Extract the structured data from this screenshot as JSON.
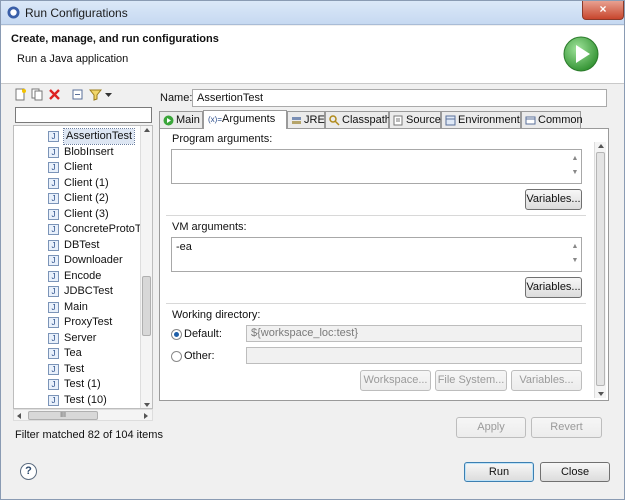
{
  "window": {
    "title": "Run Configurations",
    "close_glyph": "×"
  },
  "banner": {
    "heading": "Create, manage, and run configurations",
    "subtitle": "Run a Java application",
    "icon": "run-play-icon"
  },
  "left": {
    "filter_value": "",
    "items": [
      "AssertionTest",
      "BlobInsert",
      "Client",
      "Client (1)",
      "Client (2)",
      "Client (3)",
      "ConcreteProtoTy",
      "DBTest",
      "Downloader",
      "Encode",
      "JDBCTest",
      "Main",
      "ProxyTest",
      "Server",
      "Tea",
      "Test",
      "Test (1)",
      "Test (10)"
    ],
    "selected": "AssertionTest",
    "scroll_glyph": "III",
    "filter_status": "Filter matched 82 of 104 items"
  },
  "config": {
    "name_label": "Name:",
    "name_value": "AssertionTest",
    "tabs": [
      {
        "label": "Main",
        "icon": "main-tab-icon"
      },
      {
        "label": "Arguments",
        "icon": "arguments-tab-icon"
      },
      {
        "label": "JRE",
        "icon": "jre-tab-icon"
      },
      {
        "label": "Classpath",
        "icon": "classpath-tab-icon"
      },
      {
        "label": "Source",
        "icon": "source-tab-icon"
      },
      {
        "label": "Environment",
        "icon": "environment-tab-icon"
      },
      {
        "label": "Common",
        "icon": "common-tab-icon"
      }
    ],
    "active_tab": "Arguments",
    "program_args_label": "Program arguments:",
    "program_args_value": "",
    "variables_label": "Variables...",
    "vm_args_label": "VM arguments:",
    "vm_args_value": "-ea",
    "working_dir_label": "Working directory:",
    "default_label": "Default:",
    "default_value": "${workspace_loc:test}",
    "other_label": "Other:",
    "other_value": "",
    "workspace_btn": "Workspace...",
    "filesystem_btn": "File System...",
    "variables_btn": "Variables..."
  },
  "footer": {
    "apply": "Apply",
    "revert": "Revert",
    "run": "Run",
    "close": "Close",
    "help": "?"
  },
  "colors": {
    "accent": "#3c7fb1",
    "run_green": "#3aa63a"
  }
}
